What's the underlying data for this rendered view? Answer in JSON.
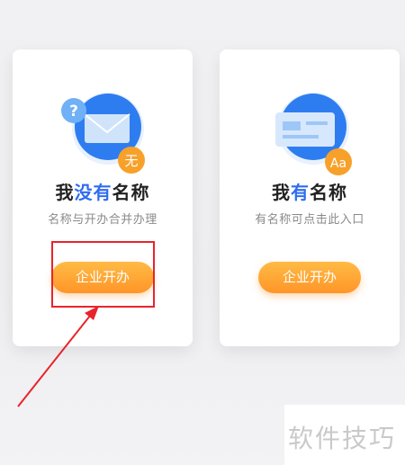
{
  "cards": [
    {
      "title_parts": [
        "我",
        "没有",
        "名称"
      ],
      "subtitle": "名称与开办合并办理",
      "button_label": "企业开办",
      "badge_text": "无",
      "question_mark": "?"
    },
    {
      "title_parts": [
        "我",
        "有",
        "名称"
      ],
      "subtitle": "有名称可点击此入口",
      "button_label": "企业开办",
      "badge_text": "Aa"
    }
  ],
  "watermark": "软件技巧",
  "colors": {
    "accent_blue": "#2f6cf0",
    "button_orange": "#ff9f30",
    "highlight_red": "#e8242b"
  }
}
